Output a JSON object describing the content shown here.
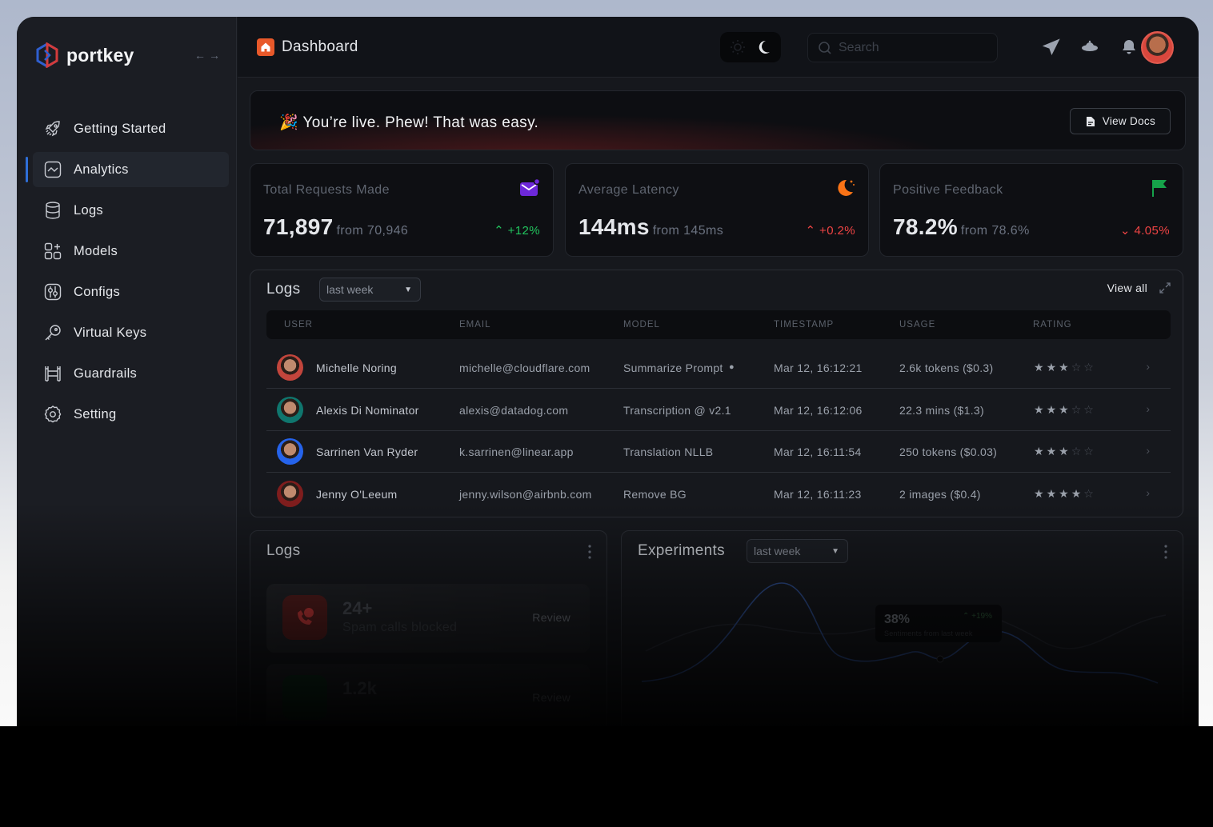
{
  "brand": {
    "name": "portkey"
  },
  "sidebar": {
    "items": [
      {
        "label": "Getting Started",
        "icon": "rocket-icon"
      },
      {
        "label": "Analytics",
        "icon": "analytics-icon",
        "active": true
      },
      {
        "label": "Logs",
        "icon": "database-icon"
      },
      {
        "label": "Models",
        "icon": "models-grid-icon"
      },
      {
        "label": "Configs",
        "icon": "configs-icon"
      },
      {
        "label": "Virtual Keys",
        "icon": "key-icon"
      },
      {
        "label": "Guardrails",
        "icon": "guardrails-icon"
      },
      {
        "label": "Setting",
        "icon": "gear-icon"
      }
    ]
  },
  "header": {
    "title": "Dashboard",
    "search_placeholder": "Search"
  },
  "banner": {
    "emoji": "🎉",
    "text": "You’re live. Phew! That was easy.",
    "button_label": "View Docs"
  },
  "stats": [
    {
      "label": "Total Requests Made",
      "value": "71,897",
      "from": "from 70,946",
      "delta": "+12%",
      "trend": "up",
      "color": "#22c55e",
      "icon": "mail-icon",
      "icon_color": "#6d28d9"
    },
    {
      "label": "Average Latency",
      "value": "144ms",
      "from": "from 145ms",
      "delta": "+0.2%",
      "trend": "up",
      "color": "#ef4444",
      "icon": "moon-icon",
      "icon_color": "#f97316"
    },
    {
      "label": "Positive Feedback",
      "value": "78.2%",
      "from": "from 78.6%",
      "delta": "4.05%",
      "trend": "down",
      "color": "#ef4444",
      "icon": "flag-icon",
      "icon_color": "#16a34a"
    }
  ],
  "logs": {
    "title": "Logs",
    "filter": "last week",
    "view_all": "View all",
    "columns": [
      "USER",
      "EMAIL",
      "MODEL",
      "TIMESTAMP",
      "USAGE",
      "RATING"
    ],
    "rows": [
      {
        "user": "Michelle Noring",
        "email": "michelle@cloudflare.com",
        "model": "Summarize Prompt",
        "timestamp": "Mar 12, 16:12:21",
        "usage": "2.6k tokens ($0.3)",
        "rating": 3,
        "avatar_color": "#c2453c"
      },
      {
        "user": "Alexis Di Nominator",
        "email": "alexis@datadog.com",
        "model": "Transcription @ v2.1",
        "timestamp": "Mar 12, 16:12:06",
        "usage": "22.3 mins ($1.3)",
        "rating": 3,
        "avatar_color": "#0f766e"
      },
      {
        "user": "Sarrinen Van Ryder",
        "email": "k.sarrinen@linear.app",
        "model": "Translation NLLB",
        "timestamp": "Mar 12, 16:11:54",
        "usage": "250 tokens ($0.03)",
        "rating": 3,
        "avatar_color": "#2563eb"
      },
      {
        "user": "Jenny O'Leeum",
        "email": "jenny.wilson@airbnb.com",
        "model": "Remove BG",
        "timestamp": "Mar 12, 16:11:23",
        "usage": "2 images ($0.4)",
        "rating": 4,
        "avatar_color": "#7f1d1d"
      }
    ]
  },
  "logs_card": {
    "title": "Logs",
    "items": [
      {
        "value": "24+",
        "label": "Spam calls blocked",
        "action": "Review"
      },
      {
        "value": "1.2k",
        "label": "",
        "action": "Review"
      }
    ]
  },
  "experiments": {
    "title": "Experiments",
    "filter": "last week",
    "tooltip": {
      "value": "38%",
      "delta": "+19%",
      "label": "Sentiments from last week"
    }
  }
}
